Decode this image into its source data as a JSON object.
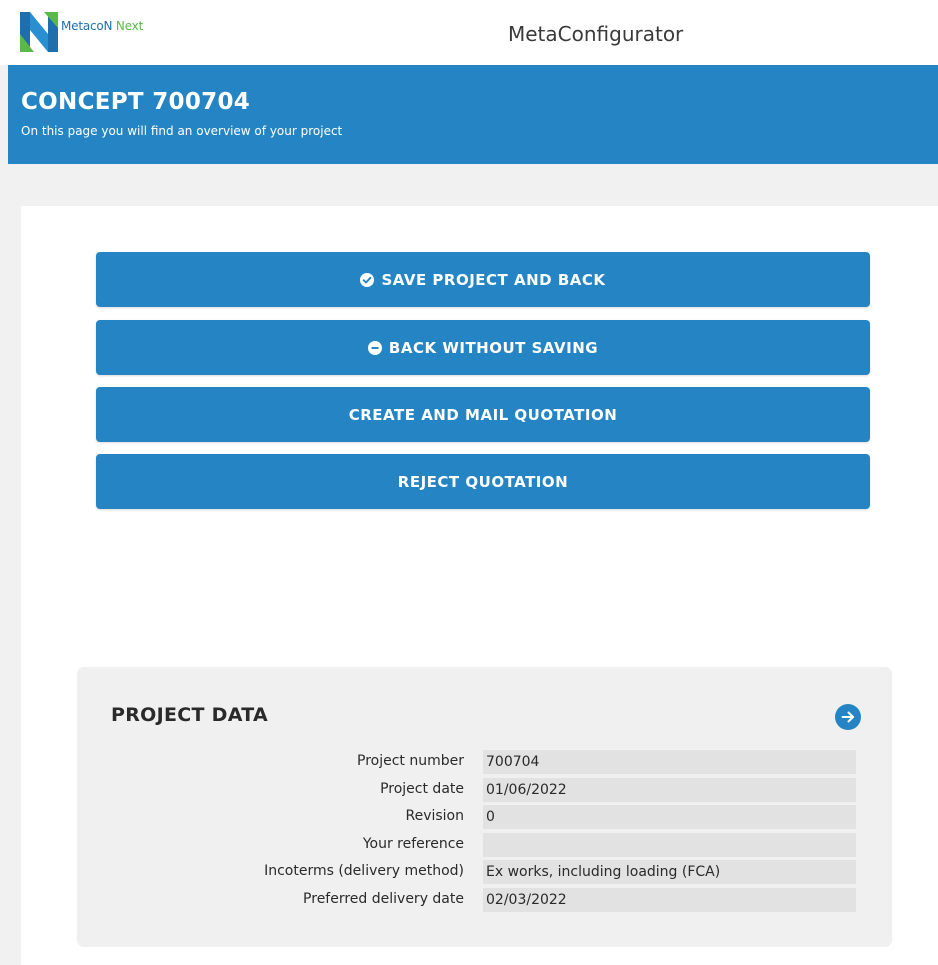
{
  "logo": {
    "part1": "MetacoN",
    "part2": " Next"
  },
  "app_title": "MetaConfigurator",
  "header": {
    "title": "CONCEPT 700704",
    "subtitle": "On this page you will find an overview of your project"
  },
  "buttons": [
    {
      "label": "SAVE PROJECT AND BACK",
      "icon": "check-circle-icon"
    },
    {
      "label": "BACK WITHOUT SAVING",
      "icon": "minus-circle-icon"
    },
    {
      "label": "CREATE AND MAIL QUOTATION",
      "icon": ""
    },
    {
      "label": "REJECT QUOTATION",
      "icon": ""
    }
  ],
  "project_data": {
    "title": "PROJECT DATA",
    "arrow_icon": "arrow-right-circle-icon",
    "rows": [
      {
        "label": "Project number",
        "value": "700704"
      },
      {
        "label": "Project date",
        "value": "01/06/2022"
      },
      {
        "label": "Revision",
        "value": "0"
      },
      {
        "label": "Your reference",
        "value": ""
      },
      {
        "label": "Incoterms (delivery method)",
        "value": "Ex works, including loading (FCA)"
      },
      {
        "label": "Preferred delivery date",
        "value": "02/03/2022"
      }
    ]
  },
  "colors": {
    "brand_blue": "#2585c4",
    "brand_green": "#5bb84a",
    "page_bg": "#f1f1f1",
    "panel_bg": "#f0f0f0",
    "field_bg": "#e2e2e2"
  }
}
